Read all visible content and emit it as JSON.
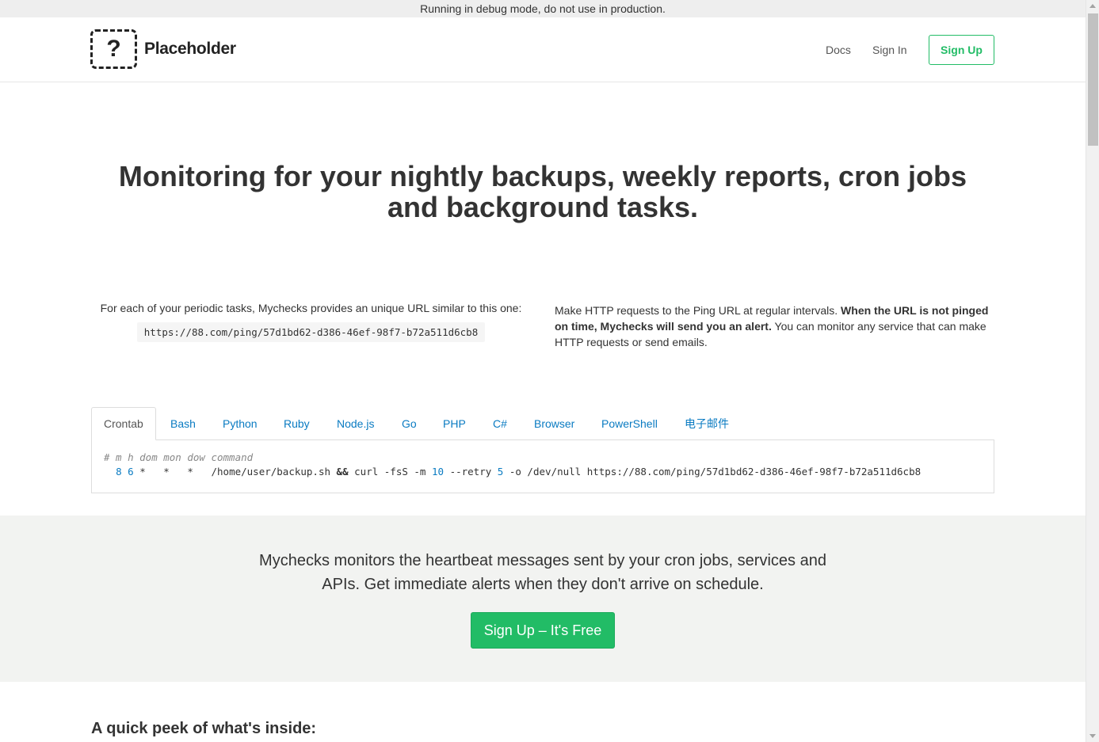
{
  "debug_bar": {
    "text": "Running in debug mode, do not use in production."
  },
  "nav": {
    "brand_icon_glyph": "?",
    "brand_name": "Placeholder",
    "docs": "Docs",
    "sign_in": "Sign In",
    "sign_up": "Sign Up"
  },
  "hero": {
    "title_line1": "Monitoring for your nightly backups, weekly reports, cron jobs",
    "title_line2": "and background tasks."
  },
  "intro": {
    "left_text": "For each of your periodic tasks, Mychecks provides an unique URL similar to this one:",
    "ping_url": "https://88.com/ping/57d1bd62-d386-46ef-98f7-b72a511d6cb8",
    "right_text_1": "Make HTTP requests to the Ping URL at regular intervals. ",
    "right_text_bold": "When the URL is not pinged on time, Mychecks will send you an alert.",
    "right_text_2": " You can monitor any service that can make HTTP requests or send emails."
  },
  "tabs": [
    "Crontab",
    "Bash",
    "Python",
    "Ruby",
    "Node.js",
    "Go",
    "PHP",
    "C#",
    "Browser",
    "PowerShell",
    "电子邮件"
  ],
  "active_tab": "Crontab",
  "code": {
    "comment": "# m h dom mon dow command",
    "minute": "8",
    "hour": "6",
    "stars": "*   *   *",
    "cmd_part1": "/home/user/backup.sh",
    "and": "&&",
    "cmd_part2": "curl -fsS -m",
    "timeout": "10",
    "retry_flag": "--retry",
    "retry": "5",
    "cmd_part3": "-o /dev/null https://88.com/ping/57d1bd62-d386-46ef-98f7-b72a511d6cb8"
  },
  "band": {
    "text_line1": "Mychecks monitors the heartbeat messages sent by your cron jobs, services and",
    "text_line2": "APIs. Get immediate alerts when they don't arrive on schedule.",
    "cta": "Sign Up – It's Free"
  },
  "peek": {
    "title": "A quick peek of what's inside:"
  },
  "colors": {
    "accent": "#22bc66",
    "link": "#0a7bc2",
    "band_bg": "#f2f3f1"
  }
}
